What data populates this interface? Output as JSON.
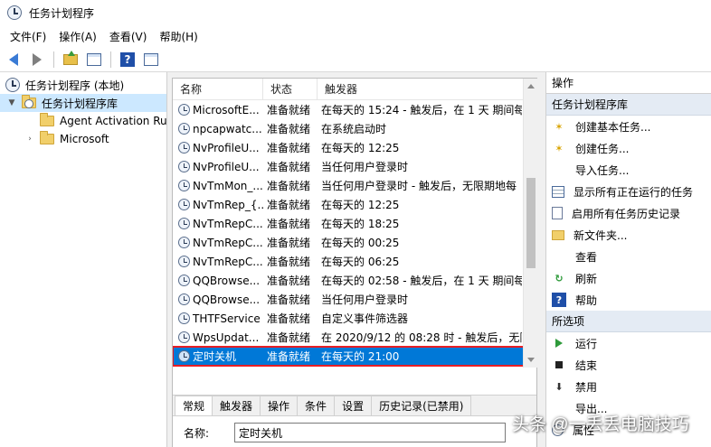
{
  "window": {
    "title": "任务计划程序"
  },
  "menu": [
    "文件(F)",
    "操作(A)",
    "查看(V)",
    "帮助(H)"
  ],
  "toolbar": {
    "help_glyph": "?"
  },
  "tree": {
    "root": "任务计划程序 (本地)",
    "library": "任务计划程序库",
    "children": [
      "Agent Activation Ru",
      "Microsoft"
    ]
  },
  "table": {
    "columns": [
      "名称",
      "状态",
      "触发器"
    ],
    "rows": [
      {
        "name": "MicrosoftE...",
        "status": "准备就绪",
        "trigger": "在每天的 15:24 - 触发后，在 1 天 期间每"
      },
      {
        "name": "npcapwatc...",
        "status": "准备就绪",
        "trigger": "在系统启动时"
      },
      {
        "name": "NvProfileU...",
        "status": "准备就绪",
        "trigger": "在每天的 12:25"
      },
      {
        "name": "NvProfileU...",
        "status": "准备就绪",
        "trigger": "当任何用户登录时"
      },
      {
        "name": "NvTmMon_...",
        "status": "准备就绪",
        "trigger": "当任何用户登录时 - 触发后，无限期地每"
      },
      {
        "name": "NvTmRep_{...",
        "status": "准备就绪",
        "trigger": "在每天的 12:25"
      },
      {
        "name": "NvTmRepC...",
        "status": "准备就绪",
        "trigger": "在每天的 18:25"
      },
      {
        "name": "NvTmRepC...",
        "status": "准备就绪",
        "trigger": "在每天的 00:25"
      },
      {
        "name": "NvTmRepC...",
        "status": "准备就绪",
        "trigger": "在每天的 06:25"
      },
      {
        "name": "QQBrowse...",
        "status": "准备就绪",
        "trigger": "在每天的 02:58 - 触发后，在 1 天 期间每"
      },
      {
        "name": "QQBrowse...",
        "status": "准备就绪",
        "trigger": "当任何用户登录时"
      },
      {
        "name": "THTFService",
        "status": "准备就绪",
        "trigger": "自定义事件筛选器"
      },
      {
        "name": "WpsUpdat...",
        "status": "准备就绪",
        "trigger": "在 2020/9/12 的 08:28 时 - 触发后，无限"
      },
      {
        "name": "定时关机",
        "status": "准备就绪",
        "trigger": "在每天的 21:00"
      }
    ]
  },
  "details": {
    "tabs": [
      "常规",
      "触发器",
      "操作",
      "条件",
      "设置",
      "历史记录(已禁用)"
    ],
    "name_label": "名称:",
    "name_value": "定时关机"
  },
  "actions": {
    "header": "操作",
    "library_header": "任务计划程序库",
    "library_items": [
      {
        "label": "创建基本任务...",
        "icon": "spark-icon"
      },
      {
        "label": "创建任务...",
        "icon": "spark-icon"
      },
      {
        "label": "导入任务...",
        "icon": ""
      },
      {
        "label": "显示所有正在运行的任务",
        "icon": "list-icon"
      },
      {
        "label": "启用所有任务历史记录",
        "icon": "doc-icon"
      },
      {
        "label": "新文件夹...",
        "icon": "folder-icon"
      },
      {
        "label": "查看",
        "icon": ""
      },
      {
        "label": "刷新",
        "icon": "refresh-icon"
      },
      {
        "label": "帮助",
        "icon": "help-icon"
      }
    ],
    "selected_header": "所选项",
    "selected_items": [
      {
        "label": "运行",
        "icon": "run-icon"
      },
      {
        "label": "结束",
        "icon": "stop-icon"
      },
      {
        "label": "禁用",
        "icon": "down-arrow-icon"
      },
      {
        "label": "导出...",
        "icon": ""
      },
      {
        "label": "属性",
        "icon": "properties-icon"
      }
    ]
  },
  "watermark": "头条 @一丢丢电脑技巧"
}
